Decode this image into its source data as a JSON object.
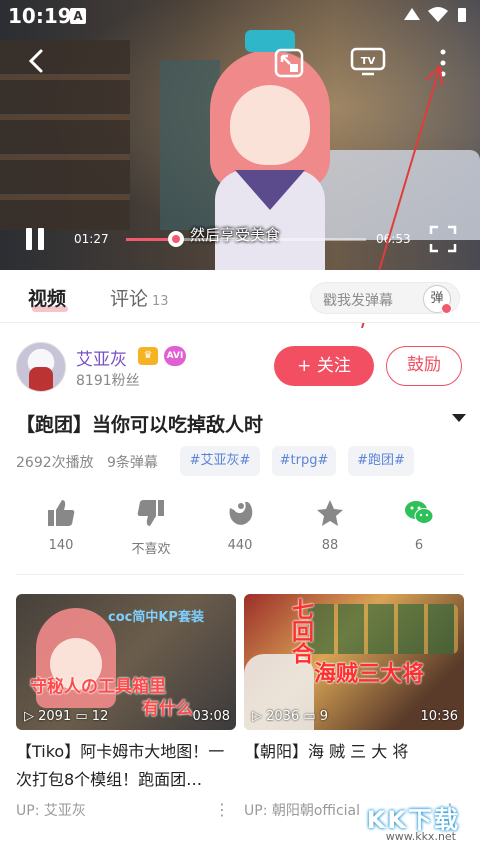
{
  "status_bar": {
    "time": "10:19",
    "a_badge": "A"
  },
  "player": {
    "current_time": "01:27",
    "total_time": "06:53",
    "progress": 0.21,
    "subtitle": "然后享受美食",
    "tv_label": "TV"
  },
  "tabs": {
    "video": "视频",
    "comment": "评论",
    "comment_count": "13",
    "danmu_placeholder": "戳我发弹幕",
    "danmu_btn": "弹"
  },
  "author": {
    "name": "艾亚灰",
    "fans": "8191粉丝",
    "badge_level": "AVI",
    "follow_label": "+ 关注",
    "cheer_label": "鼓励"
  },
  "video": {
    "title": "【跑团】当你可以吃掉敌人时",
    "plays": "2692次播放",
    "danmu": "9条弹幕",
    "tags": [
      "#艾亚灰#",
      "#trpg#",
      "#跑团#"
    ]
  },
  "actions": [
    {
      "name": "like",
      "count": "140"
    },
    {
      "name": "dislike",
      "count": "不喜欢"
    },
    {
      "name": "coin",
      "count": "440"
    },
    {
      "name": "favorite",
      "count": "88"
    },
    {
      "name": "share",
      "count": "6"
    }
  ],
  "recommendations": [
    {
      "plays": "2091",
      "comments": "12",
      "duration": "03:08",
      "cap_top": "coc简中KP套装",
      "cap_mid": "守秘人の工具箱里",
      "cap_bot": "有什么",
      "title": "【Tiko】阿卡姆市大地图！一次打包8个模组！跑面团…",
      "up": "UP: 艾亚灰"
    },
    {
      "plays": "2036",
      "comments": "9",
      "duration": "10:36",
      "cap_top": "七回合",
      "cap_mid": "海贼三大将",
      "title": "【朝阳】海 贼 三 大 将",
      "up": "UP: 朝阳朝official"
    }
  ],
  "watermark": {
    "big": "KK下载",
    "small": "www.kkx.net"
  },
  "colors": {
    "accent": "#f24f62",
    "author": "#7a4fc7",
    "tag": "#5b84d8"
  }
}
